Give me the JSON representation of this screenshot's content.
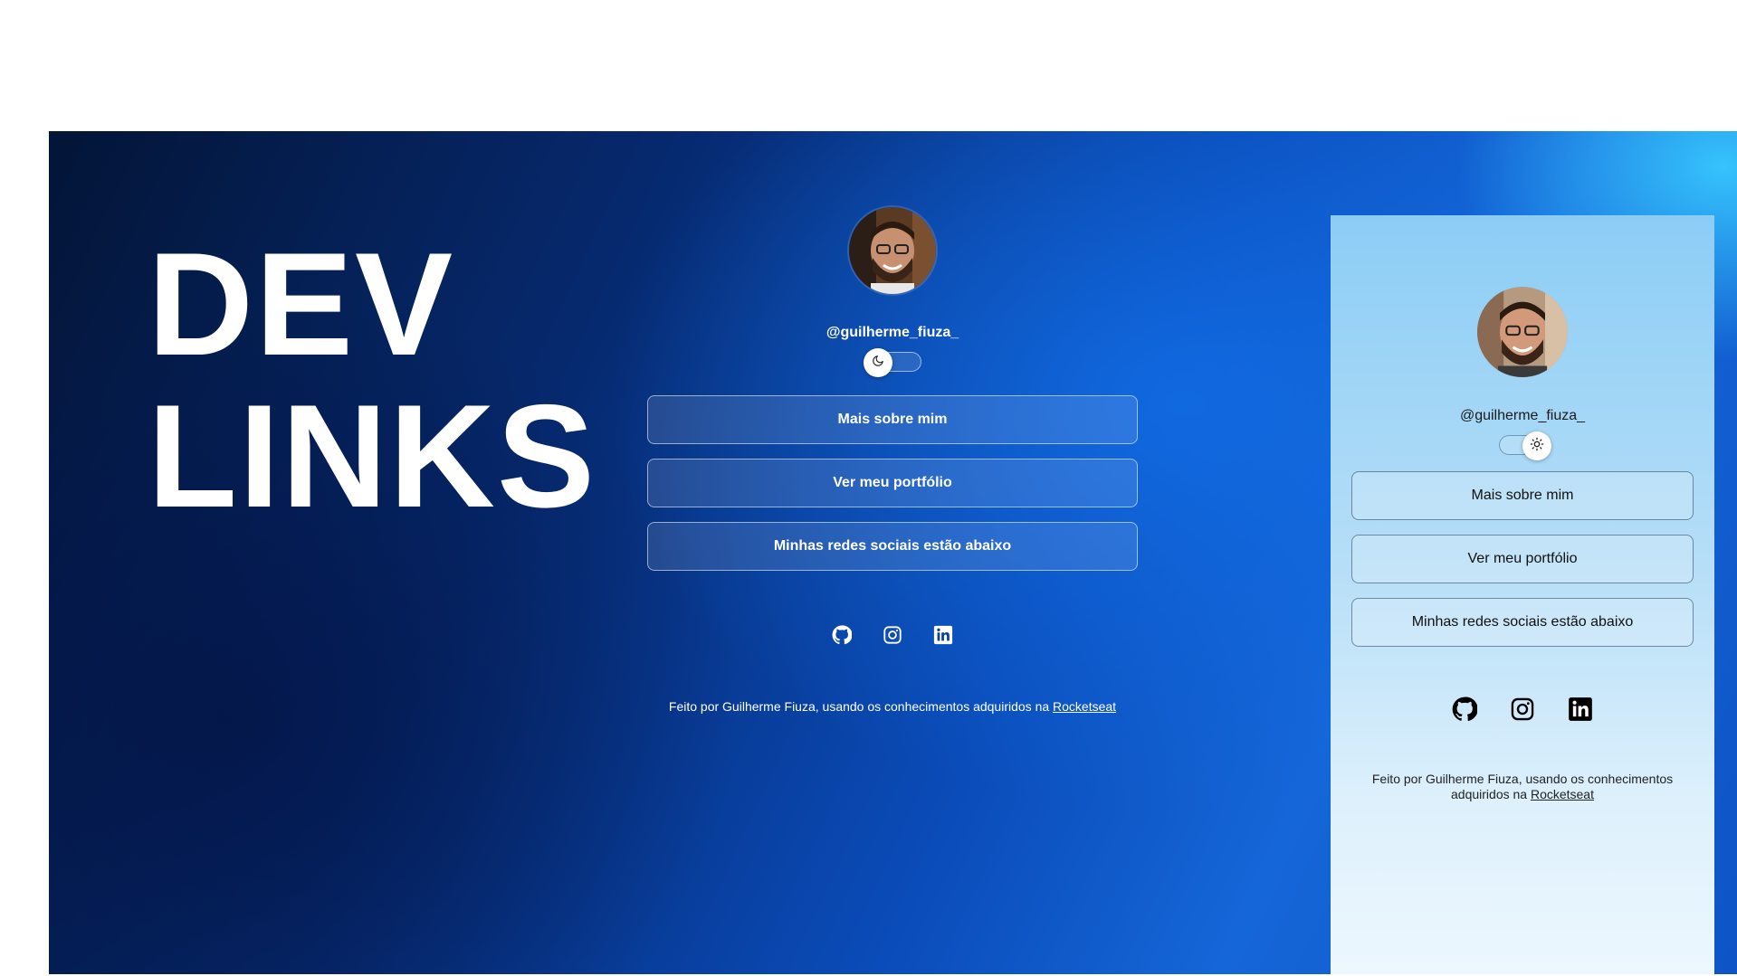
{
  "hero": {
    "line1": "DEV",
    "line2": "LINKS"
  },
  "dark_profile": {
    "handle": "@guilherme_fiuza_",
    "theme_toggle": {
      "state": "dark",
      "icon": "moon-icon"
    },
    "buttons": [
      "Mais sobre mim",
      "Ver meu portfólio",
      "Minhas redes sociais estão abaixo"
    ],
    "socials": [
      "github-icon",
      "instagram-icon",
      "linkedin-icon"
    ],
    "footer_text": "Feito por Guilherme Fiuza, usando os conhecimentos adquiridos na ",
    "footer_link": "Rocketseat"
  },
  "light_profile": {
    "handle": "@guilherme_fiuza_",
    "theme_toggle": {
      "state": "light",
      "icon": "sun-icon"
    },
    "buttons": [
      "Mais sobre mim",
      "Ver meu portfólio",
      "Minhas redes sociais estão abaixo"
    ],
    "socials": [
      "github-icon",
      "instagram-icon",
      "linkedin-icon"
    ],
    "footer_text": "Feito por Guilherme Fiuza, usando os conhecimentos adquiridos na ",
    "footer_link": "Rocketseat"
  },
  "colors": {
    "background_dark": "#031537",
    "background_accent": "#1566d8",
    "light_panel_top": "#8ccdf6",
    "light_panel_bottom": "#eef8fe"
  }
}
